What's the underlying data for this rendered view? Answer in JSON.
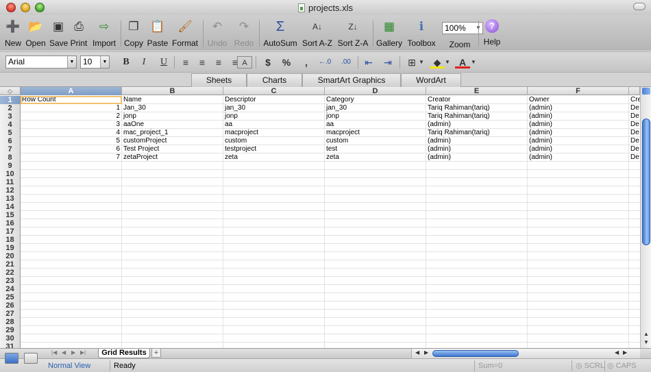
{
  "window": {
    "title": "projects.xls"
  },
  "toolbar": {
    "new": "New",
    "open": "Open",
    "save": "Save",
    "print": "Print",
    "import": "Import",
    "copy": "Copy",
    "paste": "Paste",
    "format": "Format",
    "undo": "Undo",
    "redo": "Redo",
    "autosum": "AutoSum",
    "sort_az": "Sort A-Z",
    "sort_za": "Sort Z-A",
    "gallery": "Gallery",
    "toolbox": "Toolbox",
    "zoom_value": "100%",
    "zoom": "Zoom",
    "help": "Help"
  },
  "format_bar": {
    "font": "Arial",
    "size": "10"
  },
  "ribbon_tabs": [
    "Sheets",
    "Charts",
    "SmartArt Graphics",
    "WordArt"
  ],
  "grid": {
    "columns": [
      "A",
      "B",
      "C",
      "D",
      "E",
      "F"
    ],
    "rows": [
      [
        "Row Count",
        "Name",
        "Descriptor",
        "Category",
        "Creator",
        "Owner",
        "Cre"
      ],
      [
        "1",
        "Jan_30",
        "jan_30",
        "jan_30",
        "Tariq Rahiman(tariq)",
        "(admin)",
        "De"
      ],
      [
        "2",
        "jonp",
        "jonp",
        "jonp",
        "Tariq Rahiman(tariq)",
        "(admin)",
        "De"
      ],
      [
        "3",
        "aaOne",
        "aa",
        "aa",
        "(admin)",
        "(admin)",
        "De"
      ],
      [
        "4",
        "mac_project_1",
        "macproject",
        "macproject",
        "Tariq Rahiman(tariq)",
        "(admin)",
        "De"
      ],
      [
        "5",
        "customProject",
        "custom",
        "custom",
        "(admin)",
        "(admin)",
        "De"
      ],
      [
        "6",
        "Test Project",
        "testproject",
        "test",
        "(admin)",
        "(admin)",
        "De"
      ],
      [
        "7",
        "zetaProject",
        "zeta",
        "zeta",
        "(admin)",
        "(admin)",
        "De"
      ]
    ],
    "row_numbers": [
      "1",
      "2",
      "3",
      "4",
      "5",
      "6",
      "7",
      "8",
      "9",
      "10",
      "11",
      "12",
      "13",
      "14",
      "15",
      "16",
      "17",
      "18",
      "19",
      "20",
      "21",
      "22",
      "23",
      "24",
      "25",
      "26",
      "27",
      "28",
      "29",
      "30",
      "31"
    ]
  },
  "sheet_tab": "Grid Results",
  "status": {
    "view": "Normal View",
    "state": "Ready",
    "sum": "Sum=0",
    "scrl": "SCRL",
    "caps": "CAPS"
  }
}
